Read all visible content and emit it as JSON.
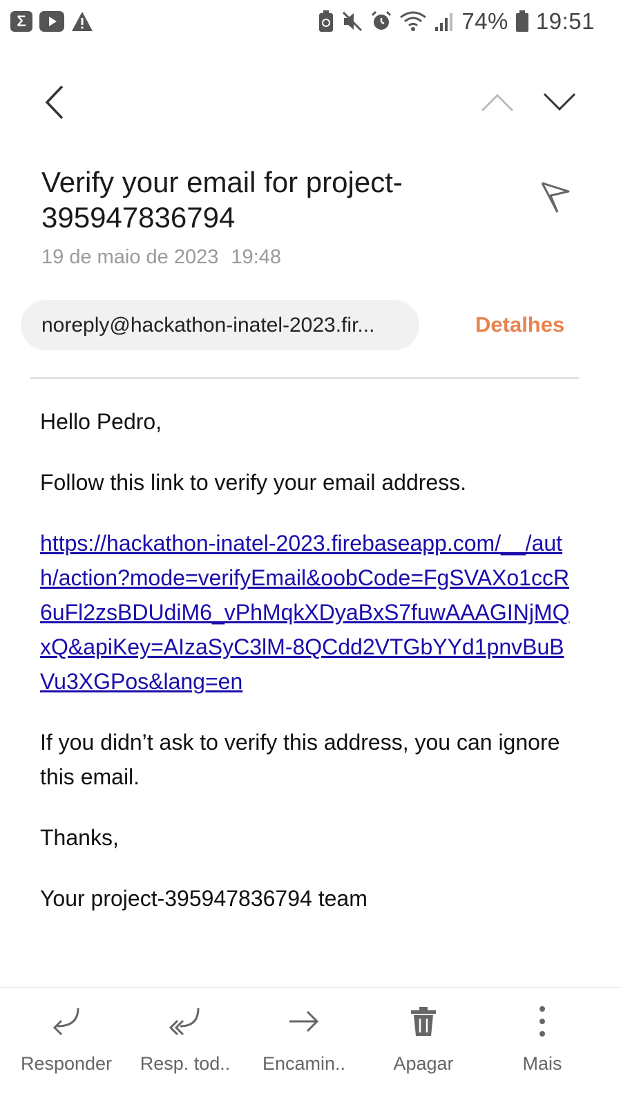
{
  "status_bar": {
    "left_icons": [
      "sigma-icon",
      "youtube-icon",
      "warning-icon"
    ],
    "right_icons": [
      "battery-saver-icon",
      "mute-icon",
      "alarm-icon",
      "wifi-icon",
      "signal-icon"
    ],
    "battery_percent": "74%",
    "time": "19:51"
  },
  "email": {
    "subject": "Verify your email for project-395947836794",
    "date": "19 de maio de 2023",
    "time": "19:48",
    "sender": "noreply@hackathon-inatel-2023.fir...",
    "details_label": "Detalhes",
    "greeting": "Hello Pedro,",
    "instruction": "Follow this link to verify your email address.",
    "link": "https://hackathon-inatel-2023.firebaseapp.com/__/auth/action?mode=verifyEmail&oobCode=FgSVAXo1ccR6uFl2zsBDUdiM6_vPhMqkXDyaBxS7fuwAAAGINjMQxQ&apiKey=AIzaSyC3lM-8QCdd2VTGbYYd1pnvBuBVu3XGPos&lang=en",
    "ignore_note": "If you didn’t ask to verify this address, you can ignore this email.",
    "thanks": "Thanks,",
    "signature": "Your project-395947836794 team"
  },
  "actions": {
    "reply": "Responder",
    "reply_all": "Resp. tod..",
    "forward": "Encamin..",
    "delete": "Apagar",
    "more": "Mais"
  },
  "colors": {
    "accent": "#e8834f",
    "link": "#1a0dab"
  }
}
